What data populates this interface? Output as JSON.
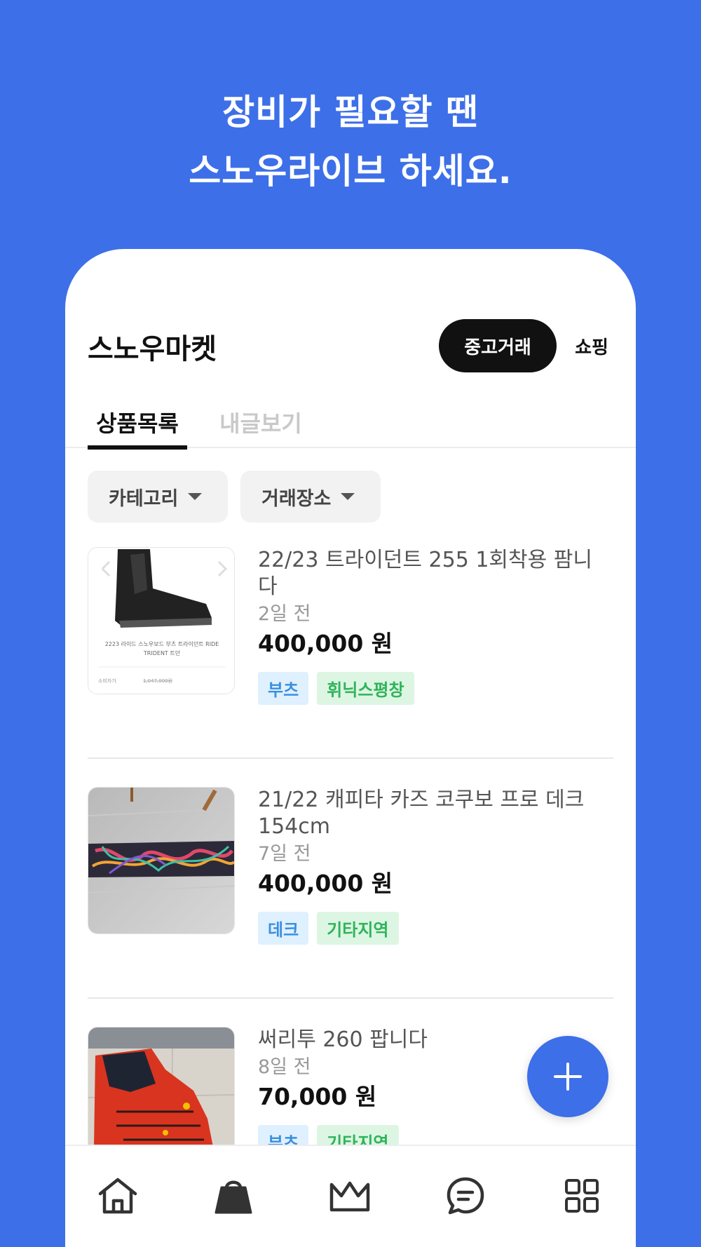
{
  "headline": {
    "line1": "장비가 필요할 땐",
    "line2": "스노우라이브 하세요."
  },
  "header": {
    "title": "스노우마켓",
    "segments": [
      "중고거래",
      "쇼핑"
    ],
    "active_segment": "중고거래"
  },
  "tabs": [
    {
      "label": "상품목록",
      "active": true
    },
    {
      "label": "내글보기",
      "active": false
    }
  ],
  "filters": [
    {
      "label": "카테고리"
    },
    {
      "label": "거래장소"
    }
  ],
  "items": [
    {
      "title": "22/23 트라이던트 255 1회착용 팜니다",
      "time": "2일 전",
      "price": "400,000 원",
      "tags": [
        {
          "label": "부츠",
          "color": "blue"
        },
        {
          "label": "휘닉스평창",
          "color": "green"
        }
      ],
      "thumb_caption": "2223 라이드 스노우보드 부츠 트라이던트 RIDE TRIDENT 트던",
      "thumb_footer_left": "소비자가",
      "thumb_footer_right": "1,047,000원"
    },
    {
      "title": "21/22 캐피타 카즈 코쿠보 프로 데크 154cm",
      "time": "7일 전",
      "price": "400,000 원",
      "tags": [
        {
          "label": "데크",
          "color": "blue"
        },
        {
          "label": "기타지역",
          "color": "green"
        }
      ]
    },
    {
      "title": "써리투 260 팝니다",
      "time": "8일 전",
      "price": "70,000 원",
      "tags": [
        {
          "label": "부츠",
          "color": "blue"
        },
        {
          "label": "기타지역",
          "color": "green"
        }
      ]
    }
  ],
  "bottom_nav": [
    {
      "icon": "home-icon",
      "active": false
    },
    {
      "icon": "shopping-bag-icon",
      "active": true
    },
    {
      "icon": "crown-icon",
      "active": false
    },
    {
      "icon": "chat-icon",
      "active": false
    },
    {
      "icon": "grid-icon",
      "active": false
    }
  ],
  "colors": {
    "brand": "#3D6FE8",
    "tag_blue_bg": "#dff0fe",
    "tag_blue_text": "#3a8fe0",
    "tag_green_bg": "#ddf6e3",
    "tag_green_text": "#2fb45a"
  }
}
